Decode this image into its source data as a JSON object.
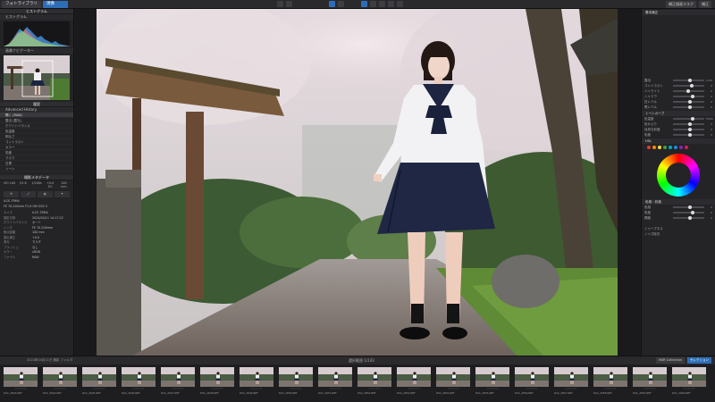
{
  "topbar": {
    "tab_library": "フォトライブラリ",
    "tab_develop": "現像",
    "right_buttons": [
      "補正描画マスク",
      "補正"
    ]
  },
  "left": {
    "section_main": "ヒストグラム",
    "histogram_label": "ヒストグラム",
    "navigator_label": "画像ナビゲーター",
    "history_label": "履歴",
    "history_title": "Advanced History",
    "history_items": [
      "開く (RAW)",
      "露出 (露光)",
      "ホワイトバランス",
      "色温度",
      "明るさ",
      "コントラスト",
      "カラー",
      "彩度",
      "マスク",
      "白黒",
      "トーン"
    ],
    "metadata_section": "撮影メタデータ",
    "exif": [
      "ISO 100",
      "f/2.8",
      "1/200s",
      "+0.0 EV",
      "100 mm"
    ],
    "camera": "ILCE-7RM4",
    "lens": "FE 70-200mm F2.8 GM OSS II",
    "meta_rows": [
      {
        "k": "カメラ",
        "v": "ILCE-7RM4"
      },
      {
        "k": "撮影日時",
        "v": "2024/04/11 14:17:22"
      },
      {
        "k": "ホワイトバランス",
        "v": "オート"
      },
      {
        "k": "レンズ",
        "v": "FE 70-200mm"
      },
      {
        "k": "焦点距離",
        "v": "100 mm"
      },
      {
        "k": "露出補正",
        "v": "+0.0"
      },
      {
        "k": "測光",
        "v": "マルチ"
      },
      {
        "k": "フラッシュ",
        "v": "なし"
      },
      {
        "k": "カラー",
        "v": "sRGB"
      },
      {
        "k": "ファイル",
        "v": "RAW"
      }
    ]
  },
  "right": {
    "sections": [
      "基本補正",
      "トーンカーブ",
      "色相・彩度",
      "HSL"
    ],
    "sliders_a": [
      {
        "label": "露出",
        "val": "0.00",
        "pos": 0.5
      },
      {
        "label": "コントラスト",
        "val": "0",
        "pos": 0.55
      },
      {
        "label": "ハイライト",
        "val": "0",
        "pos": 0.45
      },
      {
        "label": "シャドウ",
        "val": "0",
        "pos": 0.6
      },
      {
        "label": "白レベル",
        "val": "0",
        "pos": 0.5
      },
      {
        "label": "黒レベル",
        "val": "0",
        "pos": 0.5
      }
    ],
    "sliders_b": [
      {
        "label": "色温度",
        "val": "5500",
        "pos": 0.6
      },
      {
        "label": "色かぶり",
        "val": "0",
        "pos": 0.5
      },
      {
        "label": "自然な彩度",
        "val": "0",
        "pos": 0.5
      },
      {
        "label": "彩度",
        "val": "0",
        "pos": 0.5
      }
    ],
    "sliders_c": [
      {
        "label": "色相",
        "val": "0",
        "pos": 0.5
      },
      {
        "label": "彩度",
        "val": "0",
        "pos": 0.6
      },
      {
        "label": "輝度",
        "val": "0",
        "pos": 0.5
      }
    ],
    "sharpen_label": "シャープネス",
    "noise_label": "ノイズ除去",
    "swatch_colors": [
      "#e53935",
      "#fb8c00",
      "#fdd835",
      "#43a047",
      "#00acc1",
      "#1e88e5",
      "#8e24aa",
      "#d81b60"
    ]
  },
  "filmstrip": {
    "title": "選択範囲",
    "count": "1/143",
    "path": "2024年04月11日 撮影 フォルダ",
    "right_buttons": [
      "HDR Collection",
      "セレクション"
    ],
    "thumbs": [
      "DSC_2843.NEF",
      "DSC_2844.NEF",
      "DSC_2845.NEF",
      "DSC_2846.NEF",
      "DSC_2847.NEF",
      "DSC_2848.NEF",
      "DSC_2849.NEF",
      "DSC_2850.NEF",
      "DSC_2851.NEF",
      "DSC_2852.NEF",
      "DSC_2853.NEF",
      "DSC_2854.NEF",
      "DSC_2855.NEF",
      "DSC_2856.NEF",
      "DSC_2857.NEF",
      "DSC_2858.NEF",
      "DSC_2859.NEF",
      "DSC_2860.NEF"
    ]
  }
}
